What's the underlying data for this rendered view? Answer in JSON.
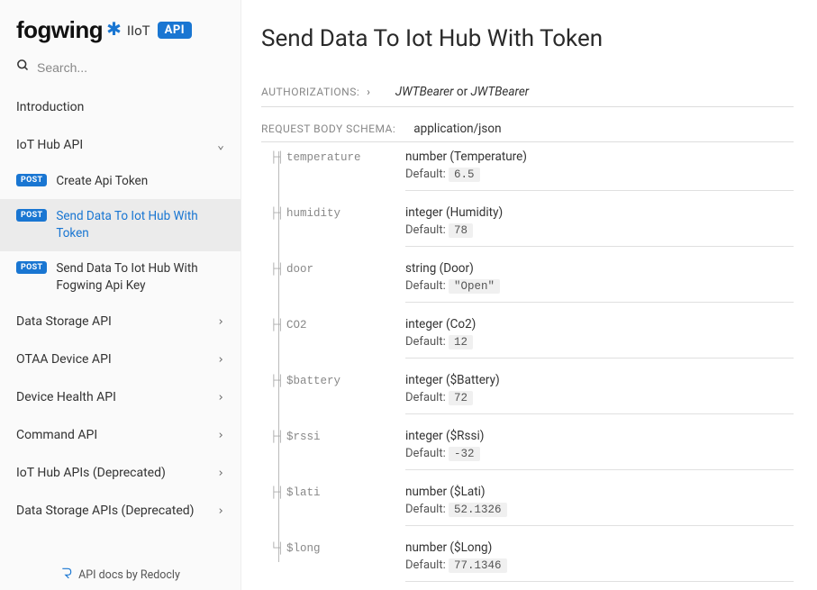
{
  "logo": {
    "brand": "fogwing",
    "sub": "IIoT",
    "badge": "API"
  },
  "search": {
    "placeholder": "Search..."
  },
  "nav": {
    "intro": "Introduction",
    "iothub": "IoT Hub API",
    "sub": {
      "create_token": "Create Api Token",
      "send_token": "Send Data To Iot Hub With Token",
      "send_apikey": "Send Data To Iot Hub With Fogwing Api Key"
    },
    "post_badge": "POST",
    "data_storage": "Data Storage API",
    "otaa": "OTAA Device API",
    "device_health": "Device Health API",
    "command": "Command API",
    "iothub_dep": "IoT Hub APIs (Deprecated)",
    "data_storage_dep": "Data Storage APIs (Deprecated)"
  },
  "footer": "API docs by Redocly",
  "page": {
    "title": "Send Data To Iot Hub With Token",
    "auth_label": "AUTHORIZATIONS:",
    "auth_value_1": "JWTBearer",
    "auth_or": " or ",
    "auth_value_2": "JWTBearer",
    "body_label": "REQUEST BODY SCHEMA:",
    "body_type": "application/json",
    "default_label": "Default:",
    "params": [
      {
        "name": "temperature",
        "type": "number (Temperature)",
        "default": "6.5"
      },
      {
        "name": "humidity",
        "type": "integer (Humidity)",
        "default": "78"
      },
      {
        "name": "door",
        "type": "string (Door)",
        "default": "\"Open\""
      },
      {
        "name": "CO2",
        "type": "integer (Co2)",
        "default": "12"
      },
      {
        "name": "$battery",
        "type": "integer ($Battery)",
        "default": "72"
      },
      {
        "name": "$rssi",
        "type": "integer ($Rssi)",
        "default": "-32"
      },
      {
        "name": "$lati",
        "type": "number ($Lati)",
        "default": "52.1326"
      },
      {
        "name": "$long",
        "type": "number ($Long)",
        "default": "77.1346"
      }
    ]
  }
}
